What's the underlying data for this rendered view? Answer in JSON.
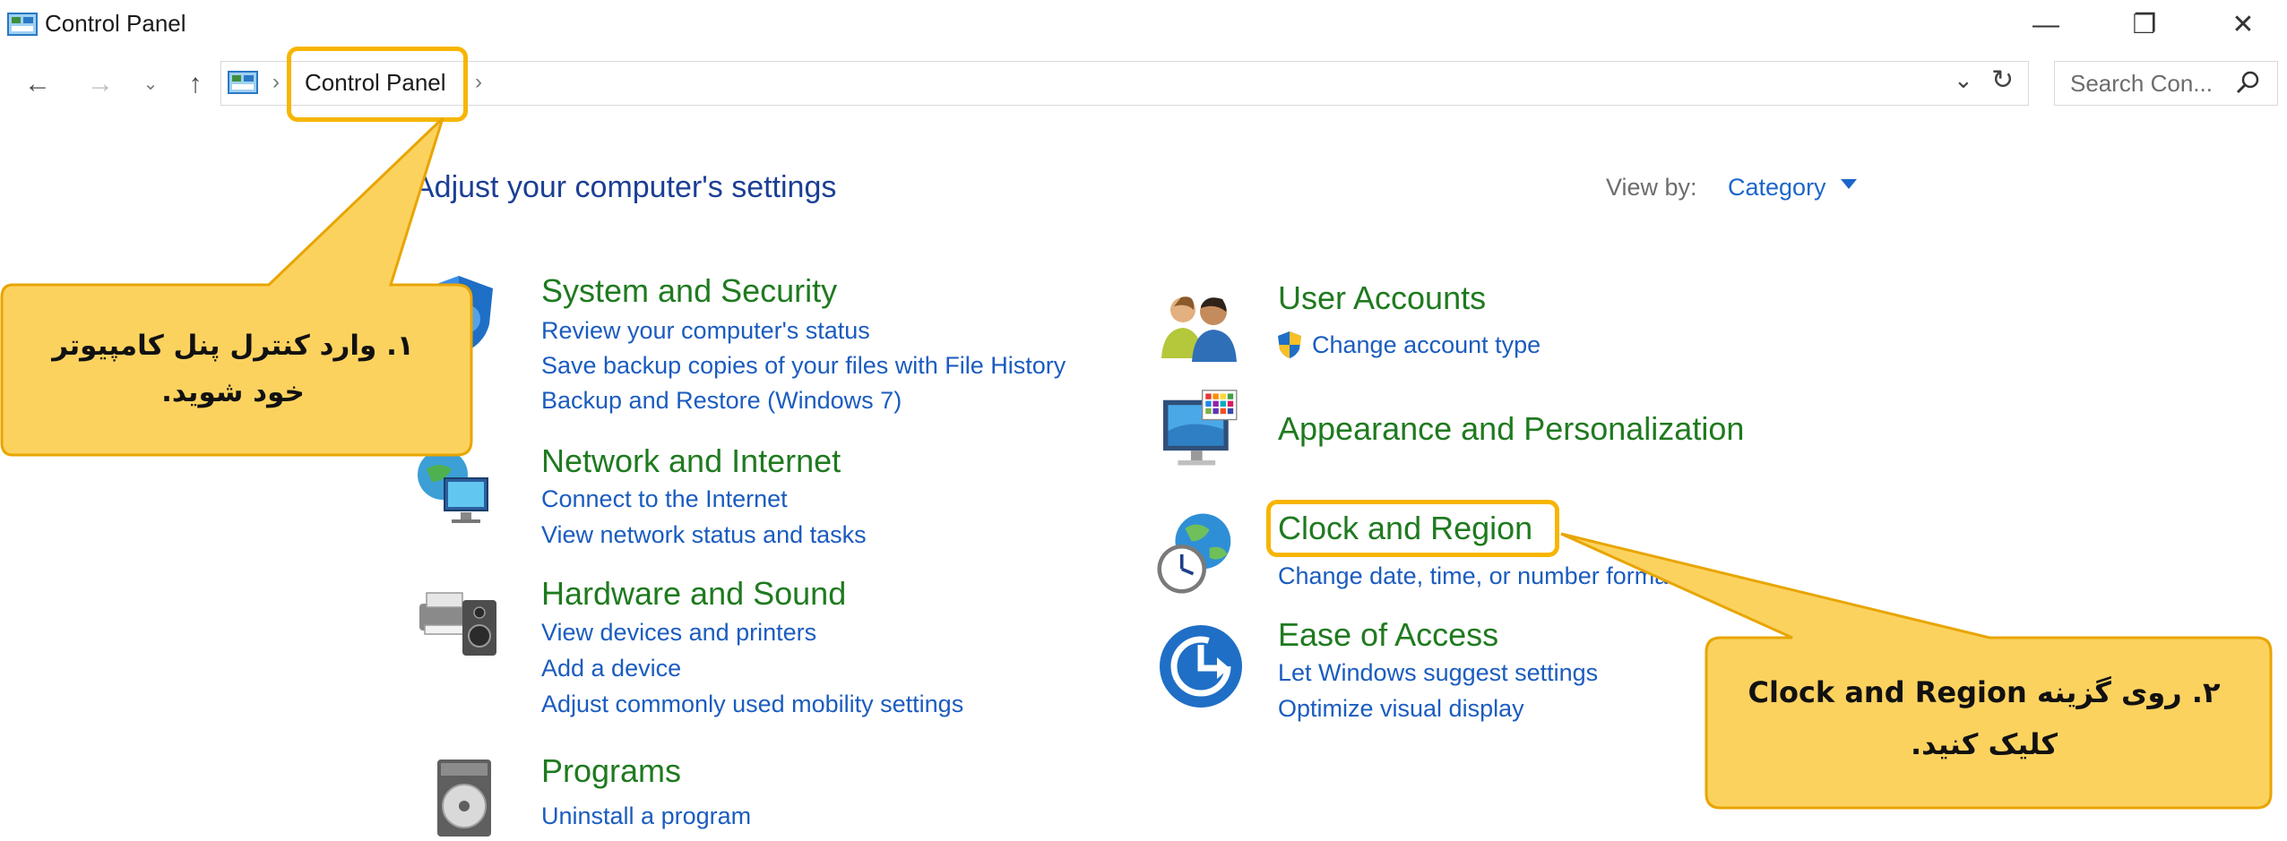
{
  "window": {
    "title": "Control Panel",
    "controls": {
      "minimize": "—",
      "restore": "❐",
      "close": "✕"
    }
  },
  "nav": {
    "back": "←",
    "forward": "→",
    "recent": "⌄",
    "up": "↑"
  },
  "address": {
    "separator": "›",
    "crumb": "Control Panel",
    "dropdown": "⌄",
    "refresh": "↻"
  },
  "search": {
    "placeholder": "Search Con..."
  },
  "main": {
    "title": "Adjust your computer's settings",
    "view_by_label": "View by:",
    "view_by_value": "Category"
  },
  "categories": [
    {
      "icon": "shield-computer-icon",
      "title": "System and Security",
      "links": [
        "Review your computer's status",
        "Save backup copies of your files with File History",
        "Backup and Restore (Windows 7)"
      ]
    },
    {
      "icon": "network-globe-icon",
      "title": "Network and Internet",
      "links": [
        "Connect to the Internet",
        "View network status and tasks"
      ]
    },
    {
      "icon": "printer-speaker-icon",
      "title": "Hardware and Sound",
      "links": [
        "View devices and printers",
        "Add a device",
        "Adjust commonly used mobility settings"
      ]
    },
    {
      "icon": "programs-disc-icon",
      "title": "Programs",
      "links": [
        "Uninstall a program"
      ]
    },
    {
      "icon": "users-icon",
      "title": "User Accounts",
      "links": [
        "Change account type"
      ]
    },
    {
      "icon": "monitor-palette-icon",
      "title": "Appearance and Personalization",
      "links": []
    },
    {
      "icon": "globe-clock-icon",
      "title": "Clock and Region",
      "links": [
        "Change date, time, or number formats"
      ]
    },
    {
      "icon": "ease-of-access-icon",
      "title": "Ease of Access",
      "links": [
        "Let Windows suggest settings",
        "Optimize visual display"
      ]
    }
  ],
  "callouts": {
    "step1": {
      "line1": "۱. وارد کنترل پنل کامپیوتر",
      "line2": "خود شوید."
    },
    "step2": {
      "line1": "۲. روی گزینه Clock and Region",
      "line2": "کلیک کنید."
    }
  },
  "colors": {
    "category_title": "#1f7a1f",
    "link": "#1b5cbf",
    "page_title": "#1c3f94",
    "highlight": "#f7b500",
    "callout_fill": "#fcd25f"
  }
}
